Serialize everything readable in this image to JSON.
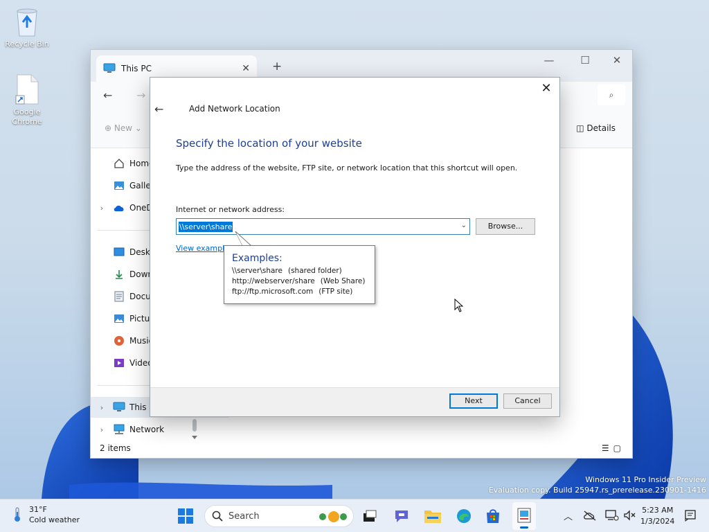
{
  "desktop": {
    "icons": [
      {
        "label": "Recycle Bin"
      },
      {
        "label": "Google Chrome"
      }
    ]
  },
  "explorer": {
    "tab_title": "This PC",
    "tab_close": "✕",
    "new_tab": "+",
    "minimize": "—",
    "maximize": "☐",
    "close": "✕",
    "back": "←",
    "forward": "→",
    "search_icon": "⌕",
    "cmd_new": "New",
    "cmd_details": "Details",
    "sidebar": [
      {
        "label": "Home",
        "icon": "home-icon"
      },
      {
        "label": "Galler",
        "icon": "gallery-icon"
      },
      {
        "label": "OneD",
        "icon": "onedrive-icon"
      },
      {
        "label": "Deskto",
        "icon": "desktop-icon"
      },
      {
        "label": "Down",
        "icon": "downloads-icon"
      },
      {
        "label": "Docur",
        "icon": "documents-icon"
      },
      {
        "label": "Pictur",
        "icon": "pictures-icon"
      },
      {
        "label": "Music",
        "icon": "music-icon"
      },
      {
        "label": "Video",
        "icon": "videos-icon"
      },
      {
        "label": "This P",
        "icon": "this-pc-icon"
      },
      {
        "label": "Network",
        "icon": "network-icon"
      }
    ],
    "status": "2 items"
  },
  "dialog": {
    "title": "Add Network Location",
    "close": "✕",
    "back": "←",
    "heading": "Specify the location of your website",
    "description": "Type the address of the website, FTP site, or network location that this shortcut will open.",
    "address_label": "Internet or network address:",
    "address_value": "\\\\server\\share",
    "browse": "Browse...",
    "view_examples": "View example",
    "next": "Next",
    "cancel": "Cancel"
  },
  "tooltip": {
    "title": "Examples:",
    "lines": [
      {
        "path": "\\\\server\\share",
        "note": "(shared folder)"
      },
      {
        "path": "http://webserver/share",
        "note": "(Web Share)"
      },
      {
        "path": "ftp://ftp.microsoft.com",
        "note": "(FTP site)"
      }
    ]
  },
  "watermark": {
    "line1": "Windows 11 Pro Insider Preview",
    "line2": "Evaluation copy. Build 25947.rs_prerelease.230901-1416"
  },
  "taskbar": {
    "weather_temp": "31°F",
    "weather_desc": "Cold weather",
    "search_placeholder": "Search",
    "time": "5:23 AM",
    "date": "1/3/2024"
  },
  "colors": {
    "accent": "#0078d7",
    "heading": "#1c3f94",
    "link": "#0066cc"
  }
}
